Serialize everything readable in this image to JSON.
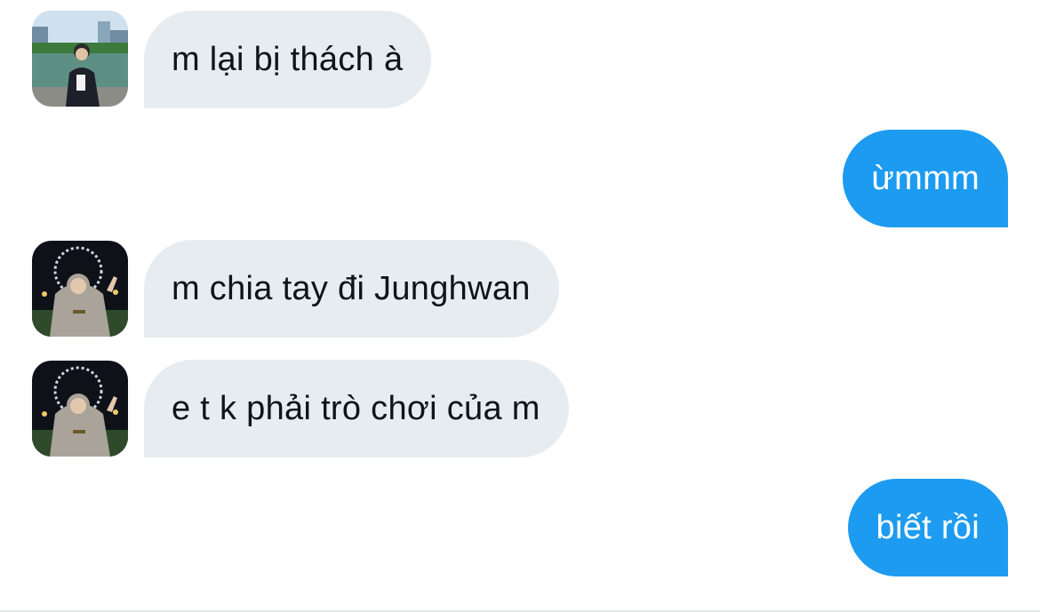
{
  "conversation": {
    "messages": [
      {
        "direction": "incoming",
        "text": "m lại bị thách à",
        "avatar": "avatar-photo-lake"
      },
      {
        "direction": "outgoing",
        "text": "ừmmm"
      },
      {
        "direction": "incoming",
        "text": "m chia tay đi Junghwan",
        "avatar": "avatar-photo-hoodie"
      },
      {
        "direction": "incoming",
        "text": "e t k phải trò chơi của m",
        "avatar": "avatar-photo-hoodie"
      },
      {
        "direction": "outgoing",
        "text": "biết rồi"
      }
    ]
  },
  "colors": {
    "incoming_bubble": "#e7ecf0",
    "incoming_text": "#0f1419",
    "outgoing_bubble": "#1d9bf0",
    "outgoing_text": "#ffffff",
    "background": "#ffffff"
  }
}
